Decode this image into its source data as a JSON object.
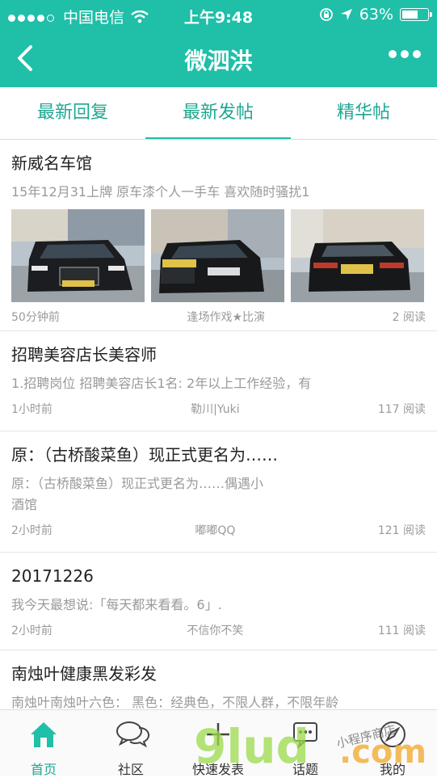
{
  "status_bar": {
    "carrier": "中国电信",
    "time": "上午9:48",
    "battery": "63%",
    "battery_level": 0.63
  },
  "nav": {
    "title": "微泗洪",
    "back_icon": "chevron-left-icon",
    "more_icon": "more-dots-icon"
  },
  "tabs": [
    {
      "label": "最新回复",
      "active": false
    },
    {
      "label": "最新发帖",
      "active": true
    },
    {
      "label": "精华帖",
      "active": false
    }
  ],
  "posts": [
    {
      "title": "新威名车馆",
      "desc": "15年12月31上牌 原车漆个人一手车 喜欢随时骚扰1",
      "time": "50分钟前",
      "author": "逢场作戏★比演",
      "reads": "2 阅读",
      "image_icons": [
        "car-front-photo",
        "car-front-photo",
        "car-rear-photo"
      ]
    },
    {
      "title": "招聘美容店长美容师",
      "desc": "1.招聘岗位 招聘美容店长1名: 2年以上工作经验，有",
      "time": "1小时前",
      "author": "勒川|Yuki",
      "reads": "117 阅读"
    },
    {
      "title": "原：（古桥酸菜鱼）现正式更名为……",
      "desc1": "原：（古桥酸菜鱼）现正式更名为……偶遇小",
      "desc2": "酒馆",
      "time": "2小时前",
      "author": "嘟嘟QQ",
      "reads": "121 阅读"
    },
    {
      "title": "20171226",
      "desc": "我今天最想说:「每天都来看看。6」.",
      "time": "2小时前",
      "author": "不信你不笑",
      "reads": "111 阅读"
    },
    {
      "title": "南烛叶健康黑发彩发",
      "desc": "南烛叶南烛叶六色： 黑色：经典色，不限人群，不限年龄"
    }
  ],
  "tabbar": [
    {
      "label": "首页",
      "icon": "home-icon",
      "active": true
    },
    {
      "label": "社区",
      "icon": "chat-bubbles-icon",
      "active": false
    },
    {
      "label": "快速发表",
      "icon": "plus-icon",
      "active": false
    },
    {
      "label": "话题",
      "icon": "topic-bubble-icon",
      "active": false
    },
    {
      "label": "我的",
      "icon": "compass-icon",
      "active": false
    }
  ],
  "watermark": {
    "text": "9lud.com",
    "subtext": "小程序商店"
  },
  "colors": {
    "brand": "#1fbfa8",
    "tab_text": "#1fa892"
  }
}
